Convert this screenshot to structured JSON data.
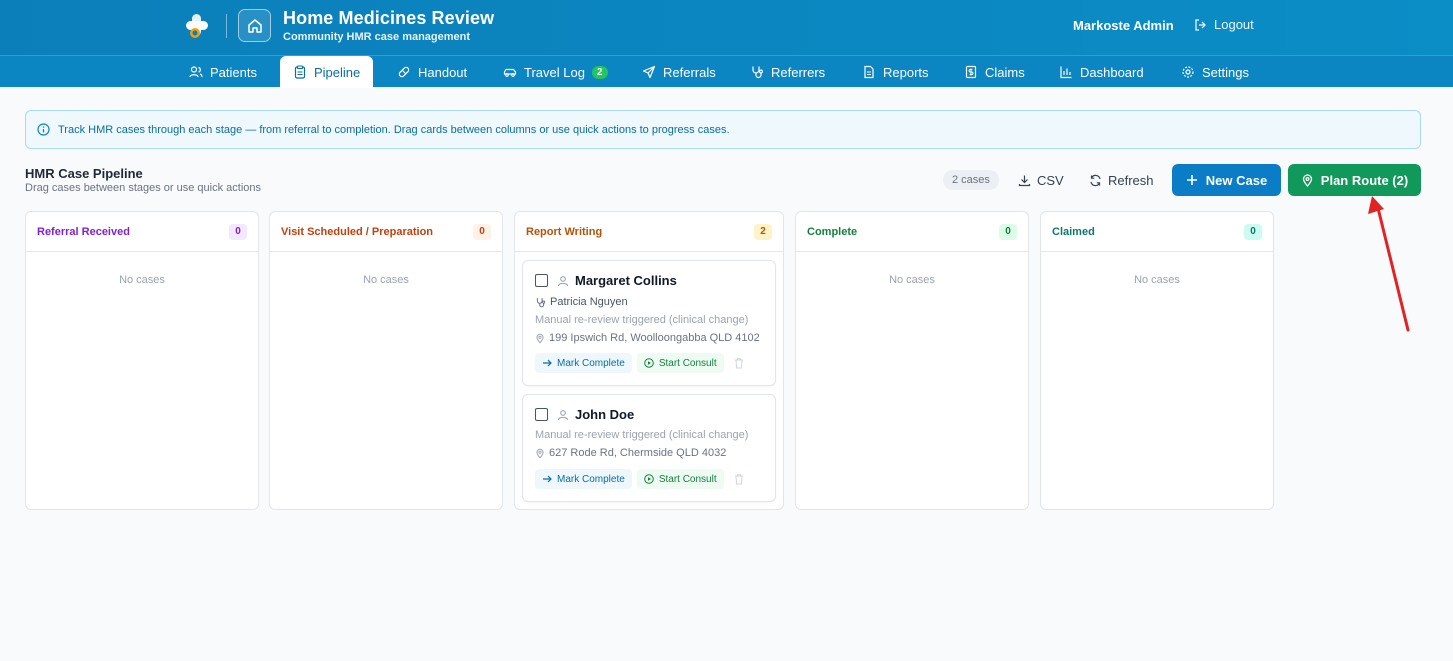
{
  "header": {
    "title": "Home Medicines Review",
    "subtitle": "Community HMR case management",
    "user": "Markoste Admin",
    "logout_label": "Logout"
  },
  "nav": {
    "patients": "Patients",
    "pipeline": "Pipeline",
    "handout": "Handout",
    "travel_log": "Travel Log",
    "travel_log_badge": "2",
    "referrals": "Referrals",
    "referrers": "Referrers",
    "reports": "Reports",
    "claims": "Claims",
    "dashboard": "Dashboard",
    "settings": "Settings"
  },
  "info_banner": "Track HMR cases through each stage — from referral to completion. Drag cards between columns or use quick actions to progress cases.",
  "pipeline": {
    "title": "HMR Case Pipeline",
    "subtitle": "Drag cases between stages or use quick actions",
    "case_count": "2 cases",
    "csv_label": "CSV",
    "refresh_label": "Refresh",
    "new_case_label": "New Case",
    "plan_route_label": "Plan Route (2)"
  },
  "columns": [
    {
      "title": "Referral Received",
      "count": "0",
      "empty": "No cases",
      "color": "#7e22ce",
      "badge_bg": "#f3e8ff"
    },
    {
      "title": "Visit Scheduled / Preparation",
      "count": "0",
      "empty": "No cases",
      "color": "#c2410c",
      "badge_bg": "#fff1e6"
    },
    {
      "title": "Report Writing",
      "count": "2",
      "empty": "",
      "color": "#b45309",
      "badge_bg": "#fef3c7"
    },
    {
      "title": "Complete",
      "count": "0",
      "empty": "No cases",
      "color": "#15803d",
      "badge_bg": "#dcfce7"
    },
    {
      "title": "Claimed",
      "count": "0",
      "empty": "No cases",
      "color": "#0f766e",
      "badge_bg": "#ccfbf1"
    }
  ],
  "cards": [
    {
      "name": "Margaret Collins",
      "referrer": "Patricia Nguyen",
      "note": "Manual re-review triggered (clinical change)",
      "address": "199 Ipswich Rd, Woolloongabba QLD 4102",
      "mark_complete": "Mark Complete",
      "start_consult": "Start Consult"
    },
    {
      "name": "John Doe",
      "note": "Manual re-review triggered (clinical change)",
      "address": "627 Rode Rd, Chermside QLD 4032",
      "mark_complete": "Mark Complete",
      "start_consult": "Start Consult"
    }
  ],
  "colors": {
    "header": "#0b7fba",
    "primary": "#0b7dc6",
    "route": "#10995a",
    "annotation_arrow": "#e02424"
  }
}
